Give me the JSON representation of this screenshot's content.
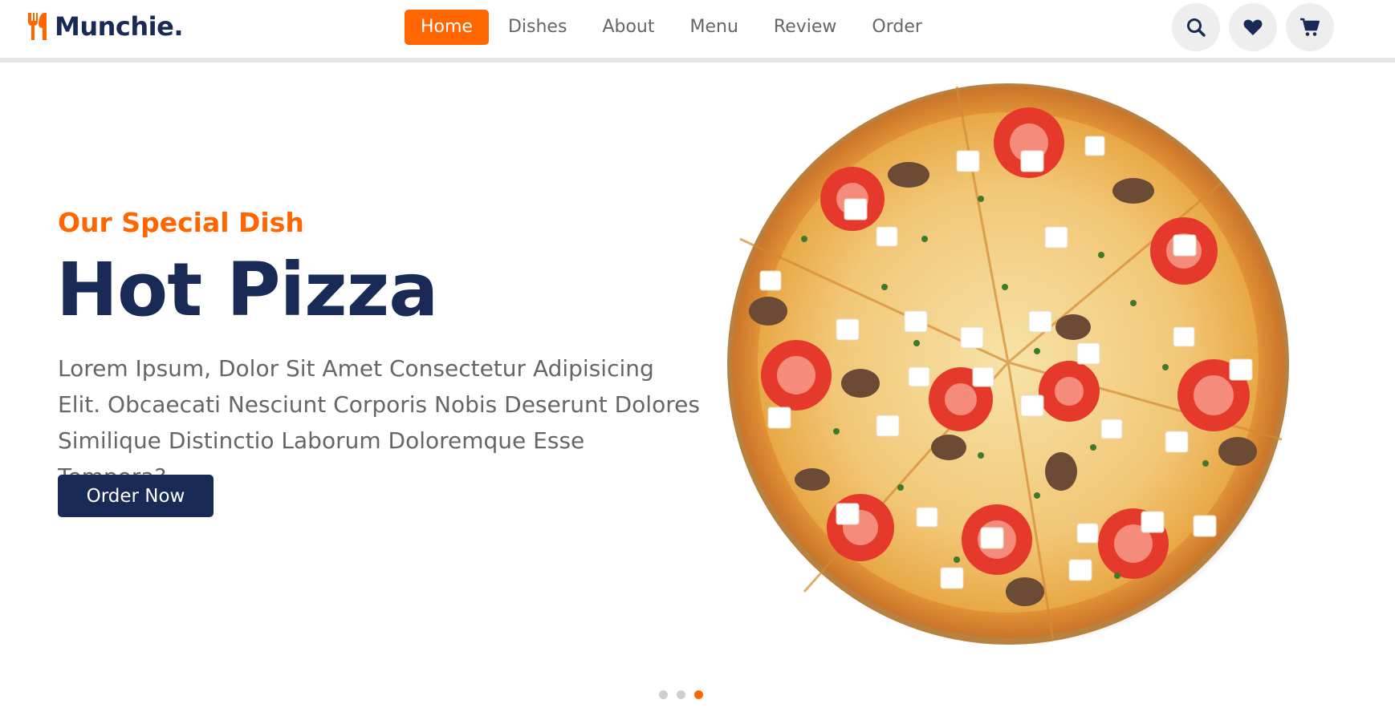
{
  "header": {
    "logo_text": "Munchie.",
    "nav": [
      {
        "label": "Home",
        "active": true
      },
      {
        "label": "Dishes",
        "active": false
      },
      {
        "label": "About",
        "active": false
      },
      {
        "label": "Menu",
        "active": false
      },
      {
        "label": "Review",
        "active": false
      },
      {
        "label": "Order",
        "active": false
      }
    ],
    "icons": [
      "search-icon",
      "heart-icon",
      "cart-icon"
    ]
  },
  "hero": {
    "subtitle": "Our Special Dish",
    "title": "Hot Pizza",
    "description": "Lorem Ipsum, Dolor Sit Amet Consectetur Adipisicing Elit. Obcaecati Nesciunt Corporis Nobis Deserunt Dolores Similique Distinctio Laborum Doloremque Esse Tempora?",
    "button_label": "Order Now",
    "image": "pizza-image"
  },
  "pagination": {
    "total": 3,
    "active_index": 2
  },
  "colors": {
    "accent": "#ff6600",
    "primary": "#192a56",
    "text_muted": "#666666",
    "icon_bg": "#eeeeee"
  }
}
